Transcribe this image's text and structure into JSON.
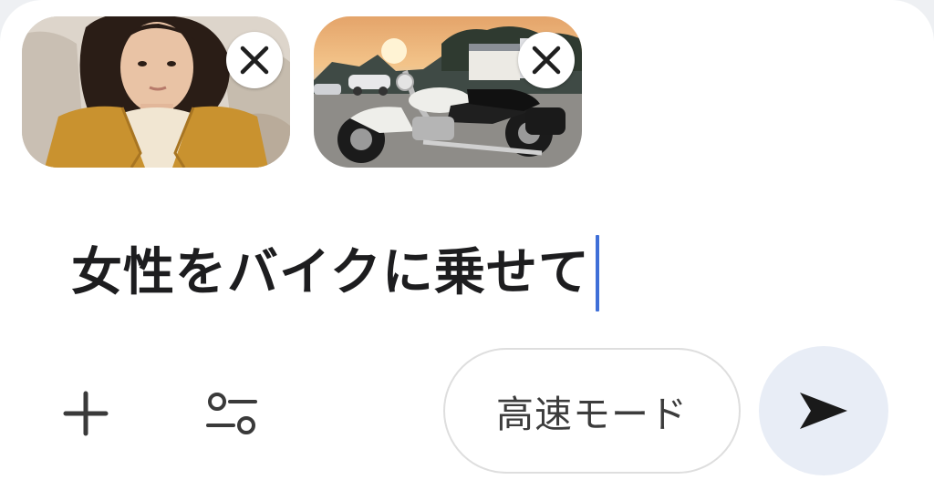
{
  "attachments": [
    {
      "description": "woman-portrait",
      "remove_icon": "close-icon"
    },
    {
      "description": "motorcycle-at-sunset",
      "remove_icon": "close-icon"
    }
  ],
  "prompt": {
    "text": "女性をバイクに乗せて"
  },
  "toolbar": {
    "add_icon": "plus-icon",
    "settings_icon": "sliders-icon",
    "mode_label": "高速モード",
    "send_icon": "send-arrow-icon"
  },
  "colors": {
    "caret": "#3f6fd8",
    "send_bg": "#e8edf6",
    "text": "#1d1d1f"
  }
}
